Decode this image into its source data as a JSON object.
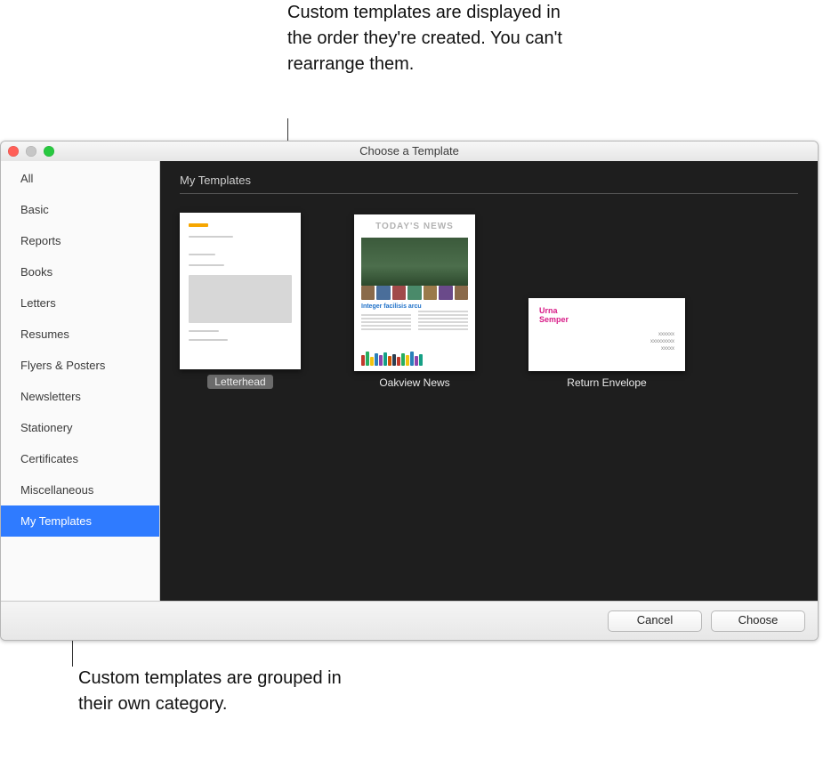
{
  "callouts": {
    "top": "Custom templates are displayed in the order they're created. You can't rearrange them.",
    "bottom": "Custom templates are grouped in their own category."
  },
  "window": {
    "title": "Choose a Template"
  },
  "sidebar": {
    "items": [
      {
        "label": "All",
        "selected": false
      },
      {
        "label": "Basic",
        "selected": false
      },
      {
        "label": "Reports",
        "selected": false
      },
      {
        "label": "Books",
        "selected": false
      },
      {
        "label": "Letters",
        "selected": false
      },
      {
        "label": "Resumes",
        "selected": false
      },
      {
        "label": "Flyers & Posters",
        "selected": false
      },
      {
        "label": "Newsletters",
        "selected": false
      },
      {
        "label": "Stationery",
        "selected": false
      },
      {
        "label": "Certificates",
        "selected": false
      },
      {
        "label": "Miscellaneous",
        "selected": false
      },
      {
        "label": "My Templates",
        "selected": true
      }
    ]
  },
  "main": {
    "section_title": "My Templates",
    "templates": [
      {
        "label": "Letterhead",
        "selected": true
      },
      {
        "label": "Oakview News",
        "selected": false
      },
      {
        "label": "Return Envelope",
        "selected": false
      }
    ],
    "news_preview": {
      "headline": "TODAY'S NEWS",
      "subhead": "Integer facilisis arcu"
    },
    "envelope_preview": {
      "name_line1": "Urna",
      "name_line2": "Semper"
    }
  },
  "footer": {
    "cancel": "Cancel",
    "choose": "Choose"
  }
}
